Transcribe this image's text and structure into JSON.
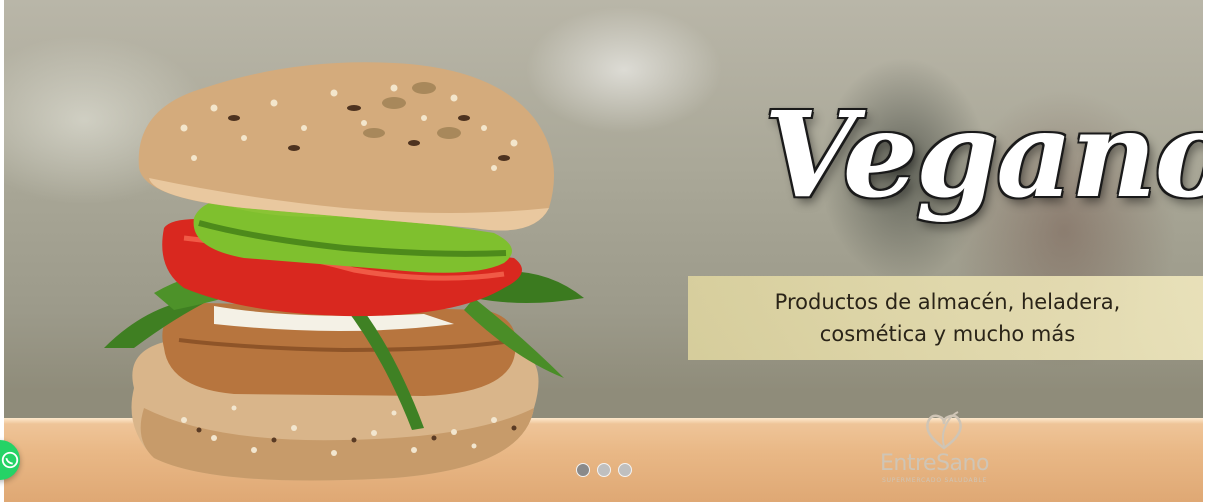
{
  "slider": {
    "title": "Vegano",
    "subtitle_line1": "Productos de almacén, heladera,",
    "subtitle_line2": "cosmética y mucho más",
    "dots": [
      {
        "label": "slide 1",
        "active": true
      },
      {
        "label": "slide 2",
        "active": false
      },
      {
        "label": "slide 3",
        "active": false
      }
    ]
  },
  "logo": {
    "name": "EntreSano",
    "tagline": "SUPERMERCADO SALUDABLE",
    "icon": "heart-leaf-icon"
  },
  "floating": {
    "icon": "whatsapp-icon",
    "color": "#25d366"
  }
}
